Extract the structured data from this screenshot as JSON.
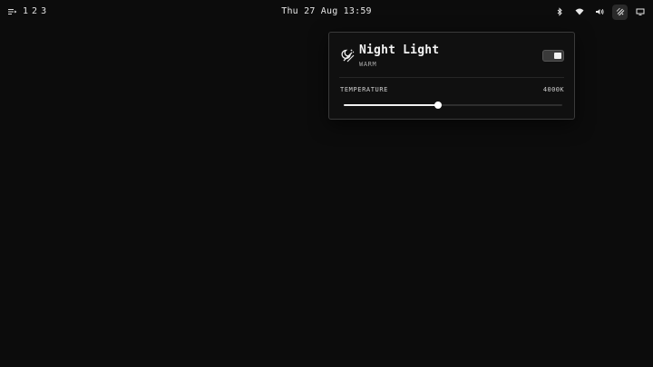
{
  "topbar": {
    "menu_icon": "menu-lines-icon",
    "workspaces": [
      "1",
      "2",
      "3"
    ],
    "clock": "Thu 27 Aug 13:59",
    "tray": [
      {
        "name": "bluetooth-icon",
        "active": false
      },
      {
        "name": "wifi-icon",
        "active": false
      },
      {
        "name": "volume-icon",
        "active": false
      },
      {
        "name": "night-light-icon",
        "active": true
      },
      {
        "name": "display-icon",
        "active": false
      }
    ]
  },
  "night_light": {
    "icon": "night-light-icon",
    "title": "Night Light",
    "subtitle": "WARM",
    "enabled": true,
    "temperature_label": "TEMPERATURE",
    "temperature_value": "4000K",
    "slider_fraction": 0.43
  }
}
